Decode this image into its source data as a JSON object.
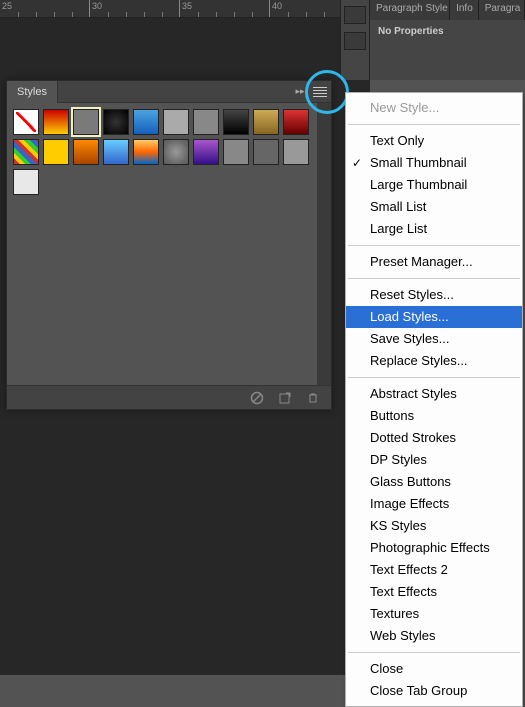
{
  "ruler": {
    "marks": [
      "25",
      "30",
      "35",
      "40"
    ]
  },
  "stylesPanel": {
    "tab": "Styles",
    "swatches": [
      {
        "bg": "none"
      },
      {
        "bg": "linear-gradient(#c00,#fc0)"
      },
      {
        "bg": "#7a7a7a",
        "sel": true
      },
      {
        "bg": "radial-gradient(#333,#000)"
      },
      {
        "bg": "linear-gradient(#4aa3df,#1560bd)"
      },
      {
        "bg": "#aaa"
      },
      {
        "bg": "#888"
      },
      {
        "bg": "linear-gradient(#444,#000)"
      },
      {
        "bg": "linear-gradient(#ccaa55,#886622)"
      },
      {
        "bg": "linear-gradient(#d33,#600)"
      },
      {
        "bg": "repeating-linear-gradient(45deg,#c33 0 4px,#fc0 4px 8px,#3c3 8px 12px,#36c 12px 16px)"
      },
      {
        "bg": "#ffcc00"
      },
      {
        "bg": "linear-gradient(#f80,#a40)"
      },
      {
        "bg": "linear-gradient(#6cf,#36c)"
      },
      {
        "bg": "linear-gradient(#fc6,#f60,#06c)"
      },
      {
        "bg": "radial-gradient(#999,#555)"
      },
      {
        "bg": "linear-gradient(#a5c,#318)"
      },
      {
        "bg": "#888"
      },
      {
        "bg": "#666"
      },
      {
        "bg": "#999"
      },
      {
        "bg": "#e8e8e8"
      }
    ]
  },
  "rightDock": {
    "tabs": [
      "Paragraph Style",
      "Info",
      "Paragra"
    ],
    "body": "No Properties"
  },
  "menu": {
    "items": [
      {
        "label": "New Style...",
        "disabled": true
      },
      {
        "sep": true
      },
      {
        "label": "Text Only"
      },
      {
        "label": "Small Thumbnail",
        "checked": true
      },
      {
        "label": "Large Thumbnail"
      },
      {
        "label": "Small List"
      },
      {
        "label": "Large List"
      },
      {
        "sep": true
      },
      {
        "label": "Preset Manager..."
      },
      {
        "sep": true
      },
      {
        "label": "Reset Styles..."
      },
      {
        "label": "Load Styles...",
        "highlight": true
      },
      {
        "label": "Save Styles..."
      },
      {
        "label": "Replace Styles..."
      },
      {
        "sep": true
      },
      {
        "label": "Abstract Styles"
      },
      {
        "label": "Buttons"
      },
      {
        "label": "Dotted Strokes"
      },
      {
        "label": "DP Styles"
      },
      {
        "label": "Glass Buttons"
      },
      {
        "label": "Image Effects"
      },
      {
        "label": "KS Styles"
      },
      {
        "label": "Photographic Effects"
      },
      {
        "label": "Text Effects 2"
      },
      {
        "label": "Text Effects"
      },
      {
        "label": "Textures"
      },
      {
        "label": "Web Styles"
      },
      {
        "sep": true
      },
      {
        "label": "Close"
      },
      {
        "label": "Close Tab Group"
      }
    ]
  }
}
